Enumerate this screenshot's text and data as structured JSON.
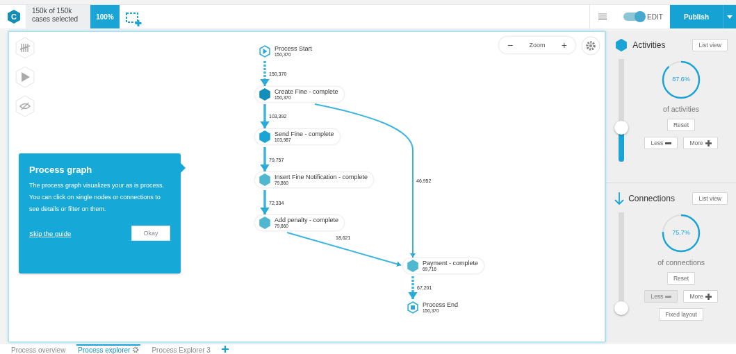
{
  "topbar": {
    "logo": "C",
    "selection": [
      "150k of 150k",
      "cases selected"
    ],
    "percent": "100%",
    "edit_toggle": {
      "label": "EDIT",
      "on": true
    },
    "publish": "Publish"
  },
  "graph": {
    "zoom_label": "Zoom",
    "zoom_out": "−",
    "zoom_in": "+",
    "nodes": [
      {
        "kind": "start",
        "name": "Process Start",
        "count": "150,370",
        "color": "#29aad8"
      },
      {
        "kind": "activity",
        "name": "Create Fine - complete",
        "count": "150,370",
        "color": "#138eb8"
      },
      {
        "kind": "activity",
        "name": "Send Fine - complete",
        "count": "103,987",
        "color": "#1aa4d6"
      },
      {
        "kind": "activity",
        "name": "Insert Fine Notification - complete",
        "count": "79,860",
        "color": "#4fb8d0"
      },
      {
        "kind": "activity",
        "name": "Add penalty - complete",
        "count": "79,860",
        "color": "#4fb8d0"
      },
      {
        "kind": "activity",
        "name": "Payment - complete",
        "count": "69,716",
        "color": "#4fb8d0"
      },
      {
        "kind": "end",
        "name": "Process End",
        "count": "150,370",
        "color": "#29aad8"
      }
    ],
    "edges": [
      {
        "kind": "dotted",
        "label": "150,370"
      },
      {
        "kind": "solid",
        "label": "103,392"
      },
      {
        "kind": "solid",
        "label": "79,757"
      },
      {
        "kind": "solid",
        "label": "72,334"
      },
      {
        "kind": "solid",
        "label": "46,952"
      },
      {
        "kind": "solid",
        "label": "18,621"
      },
      {
        "kind": "dotted",
        "label": "67,201"
      }
    ]
  },
  "guide": {
    "title": "Process graph",
    "text": "The process graph visualizes your as is process. You can click on single nodes or connections to see details or filter on them.",
    "skip": "Skip the guide",
    "ok": "Okay"
  },
  "panel": [
    {
      "kind": "activities",
      "title": "Activities",
      "list_view": "List view",
      "level": 0.33,
      "percent": "87.6%",
      "caption": "of activities",
      "reset": "Reset",
      "less": {
        "label": "Less",
        "disabled": false
      },
      "more": "More"
    },
    {
      "kind": "connections",
      "title": "Connections",
      "list_view": "List view",
      "level": 0.07,
      "percent": "75.7%",
      "caption": "of connections",
      "reset": "Reset",
      "less": {
        "label": "Less",
        "disabled": true
      },
      "more": "More",
      "fixed_layout": "Fixed layout"
    }
  ],
  "tabs": [
    {
      "label": "Process overview",
      "selected": false
    },
    {
      "label": "Process explorer",
      "selected": true
    },
    {
      "label": "Process Explorer 3",
      "selected": false
    }
  ]
}
